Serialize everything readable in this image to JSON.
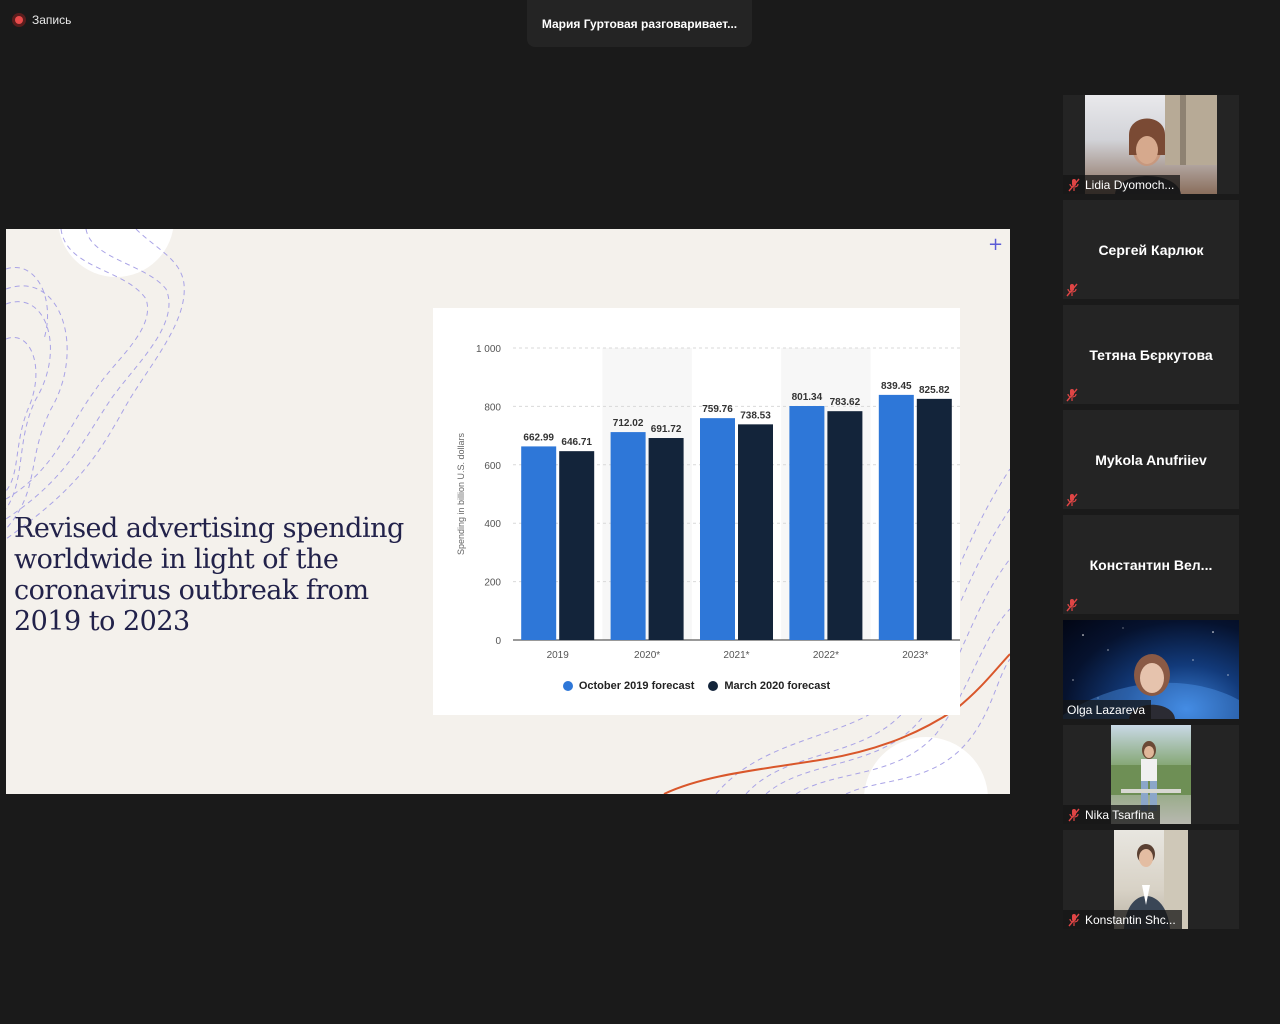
{
  "recording": {
    "label": "Запись"
  },
  "active_speaker": {
    "text": "Мария Гуртовая разговаривает..."
  },
  "slide": {
    "title": "Revised advertising spending worldwide in light of the coronavirus outbreak from 2019 to 2023",
    "plus_symbol": "+"
  },
  "chart_data": {
    "type": "bar",
    "categories": [
      "2019",
      "2020*",
      "2021*",
      "2022*",
      "2023*"
    ],
    "series": [
      {
        "name": "October 2019 forecast",
        "values": [
          662.99,
          712.02,
          759.76,
          801.34,
          839.45
        ],
        "color": "#2e77d8"
      },
      {
        "name": "March 2020 forecast",
        "values": [
          646.71,
          691.72,
          738.53,
          783.62,
          825.82
        ],
        "color": "#13243a"
      }
    ],
    "value_labels": [
      [
        "662.99",
        "712.02",
        "759.76",
        "801.34",
        "839.45"
      ],
      [
        "646.71",
        "691.72",
        "738.53",
        "783.62",
        "825.82"
      ]
    ],
    "ylabel": "Spending in billion U.S. dollars",
    "ylim": [
      0,
      1000
    ],
    "yticks": [
      0,
      200,
      400,
      600,
      800,
      1000
    ],
    "ytick_labels": [
      "0",
      "200",
      "400",
      "600",
      "800",
      "1 000"
    ],
    "grid": true,
    "legend_position": "bottom-center"
  },
  "participants": [
    {
      "name": "Lidia Dyomoch...",
      "video": true,
      "muted": true
    },
    {
      "name": "Сергей Карлюк",
      "video": false,
      "muted": true
    },
    {
      "name": "Тетяна Бєркутова",
      "video": false,
      "muted": true
    },
    {
      "name": "Mykola Anufriiev",
      "video": false,
      "muted": true
    },
    {
      "name": "Константин  Вел...",
      "video": false,
      "muted": true
    },
    {
      "name": "Olga Lazareva",
      "video": true,
      "muted": false
    },
    {
      "name": "Nika Tsarfina",
      "video": true,
      "muted": true
    },
    {
      "name": "Konstantin Shc...",
      "video": true,
      "muted": true
    }
  ],
  "icons": {
    "mute": "mic-muted-icon",
    "record": "record-icon",
    "plus": "plus-icon"
  }
}
